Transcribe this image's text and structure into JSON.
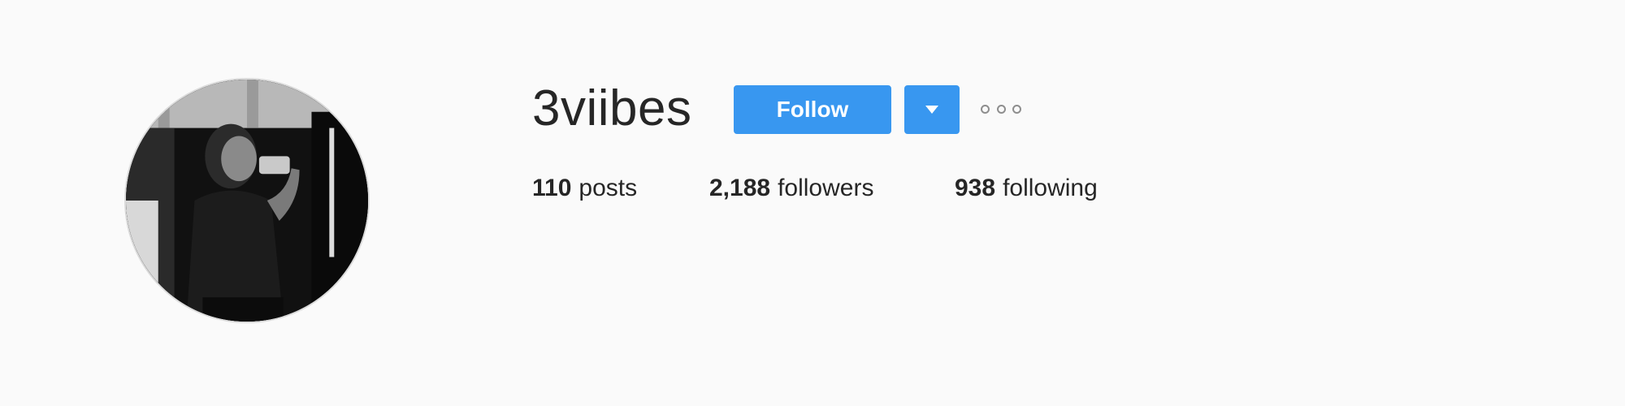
{
  "profile": {
    "username": "3viibes",
    "follow_label": "Follow",
    "avatar_icon": "profile-photo",
    "dropdown_icon": "caret-down-icon",
    "options_icon": "more-options-icon",
    "stats": {
      "posts_count": "110",
      "posts_label": "posts",
      "followers_count": "2,188",
      "followers_label": "followers",
      "following_count": "938",
      "following_label": "following"
    }
  },
  "colors": {
    "background": "#fafafa",
    "accent": "#3897f0",
    "text": "#262626",
    "muted": "#8e8e8e"
  }
}
